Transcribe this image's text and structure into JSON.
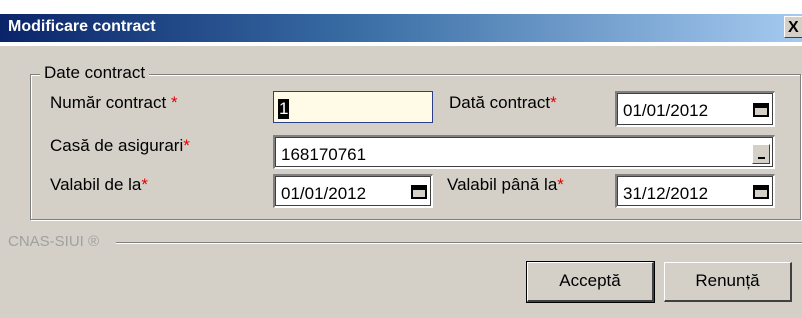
{
  "window": {
    "title": "Modificare contract",
    "close_label": "X"
  },
  "group": {
    "legend": "Date contract"
  },
  "fields": {
    "numar_contract": {
      "label": "Număr contract",
      "value": "1"
    },
    "data_contract": {
      "label": "Dată contract",
      "value": "01/01/2012"
    },
    "casa_asigurari": {
      "label": "Casă de asigurari",
      "value": "168170761"
    },
    "valabil_de_la": {
      "label": "Valabil de la",
      "value": "01/01/2012"
    },
    "valabil_pana_la": {
      "label": "Valabil până la",
      "value": "31/12/2012"
    }
  },
  "required_mark": "*",
  "footer": {
    "label": "CNAS-SIUI ®"
  },
  "buttons": {
    "accept": "Acceptă",
    "cancel": "Renunță"
  },
  "colors": {
    "required": "#e00000",
    "title_gradient_start": "#0a246a",
    "focused_bg": "#fffbe6"
  }
}
